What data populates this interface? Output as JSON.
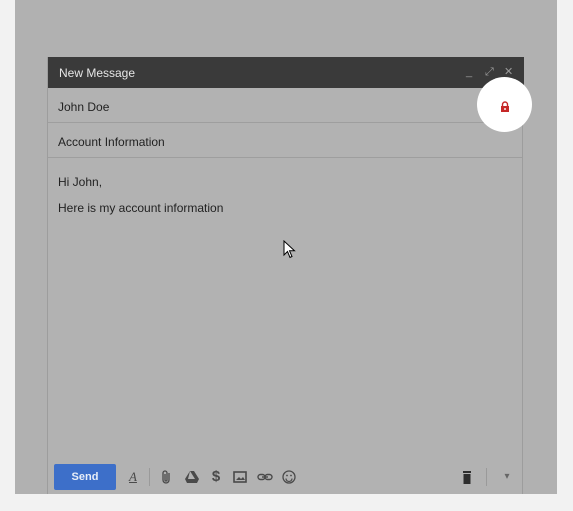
{
  "compose": {
    "title": "New Message",
    "controls": {
      "minimize": "_",
      "expand": "⤢",
      "close": "✕"
    },
    "to_value": "John Doe",
    "subject_value": "Account Information",
    "body_lines": [
      "Hi John,",
      "Here is my account information"
    ]
  },
  "toolbar": {
    "send_label": "Send",
    "format_glyph": "A",
    "money_glyph": "$",
    "more_glyph": "▾",
    "icons": [
      "format-text-icon",
      "attach-icon",
      "drive-icon",
      "money-icon",
      "photo-icon",
      "link-icon",
      "emoji-icon",
      "trash-icon",
      "more-options-icon"
    ]
  },
  "colors": {
    "send": "#3d6fc9",
    "lock": "#c62828",
    "titlebar": "#3a3a3a"
  }
}
